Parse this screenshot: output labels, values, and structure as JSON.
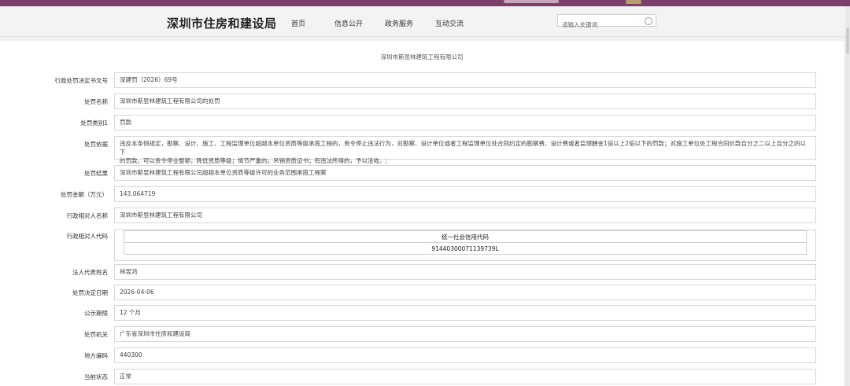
{
  "header": {
    "site_title": "深圳市住房和建设局",
    "nav": [
      "首页",
      "信息公开",
      "政务服务",
      "互动交流"
    ],
    "search_placeholder": "请输入关键词"
  },
  "page_title": "深圳市斯昱林建筑工程有限公司",
  "fields": [
    {
      "label": "行政处罚决定书文号",
      "value": "深建罚〔2026〕69号"
    },
    {
      "label": "处罚名称",
      "value": "深圳市斯昱林建筑工程有限公司的处罚"
    },
    {
      "label": "处罚类别1",
      "value": "罚款"
    },
    {
      "label": "处罚依据",
      "value_lines": [
        "违反本条例规定，勘察、设计、施工、工程监理单位超越本单位资质等级承揽工程的，责令停止违法行为，对勘察、设计单位或者工程监理单位处合同约定的勘察费、设计费或者监理酬金1倍以上2倍以下的罚款；对施工单位处工程合同价款百分之二以上百分之四以下",
        "的罚款，可以责令停业整顿，降低资质等级；情节严重的，吊销资质证书；有违法所得的，予以没收。;"
      ]
    },
    {
      "label": "处罚结果",
      "value": "深圳市斯昱林建筑工程有限公司超越本单位资质等级许可的业务范围承揽工程案"
    },
    {
      "label": "处罚金额（万元）",
      "value": "143.064719"
    },
    {
      "label": "行政相对人名称",
      "value": "深圳市斯昱林建筑工程有限公司"
    },
    {
      "label": "行政相对人代码",
      "table_header": "统一社会信用代码",
      "table_value": "91440300071139739L"
    },
    {
      "label": "法人代表姓名",
      "value": "林昱鸿"
    },
    {
      "label": "处罚决定日期",
      "value": "2026-04-06"
    },
    {
      "label": "公示期限",
      "value": "12 个月"
    },
    {
      "label": "处罚机关",
      "value": "广东省深圳市住房和建设局"
    },
    {
      "label": "地方编码",
      "value": "440300"
    },
    {
      "label": "当前状态",
      "value": "正常"
    }
  ],
  "colors": {
    "top_bar": "#7a3f6a",
    "border": "#d7d7d7"
  }
}
